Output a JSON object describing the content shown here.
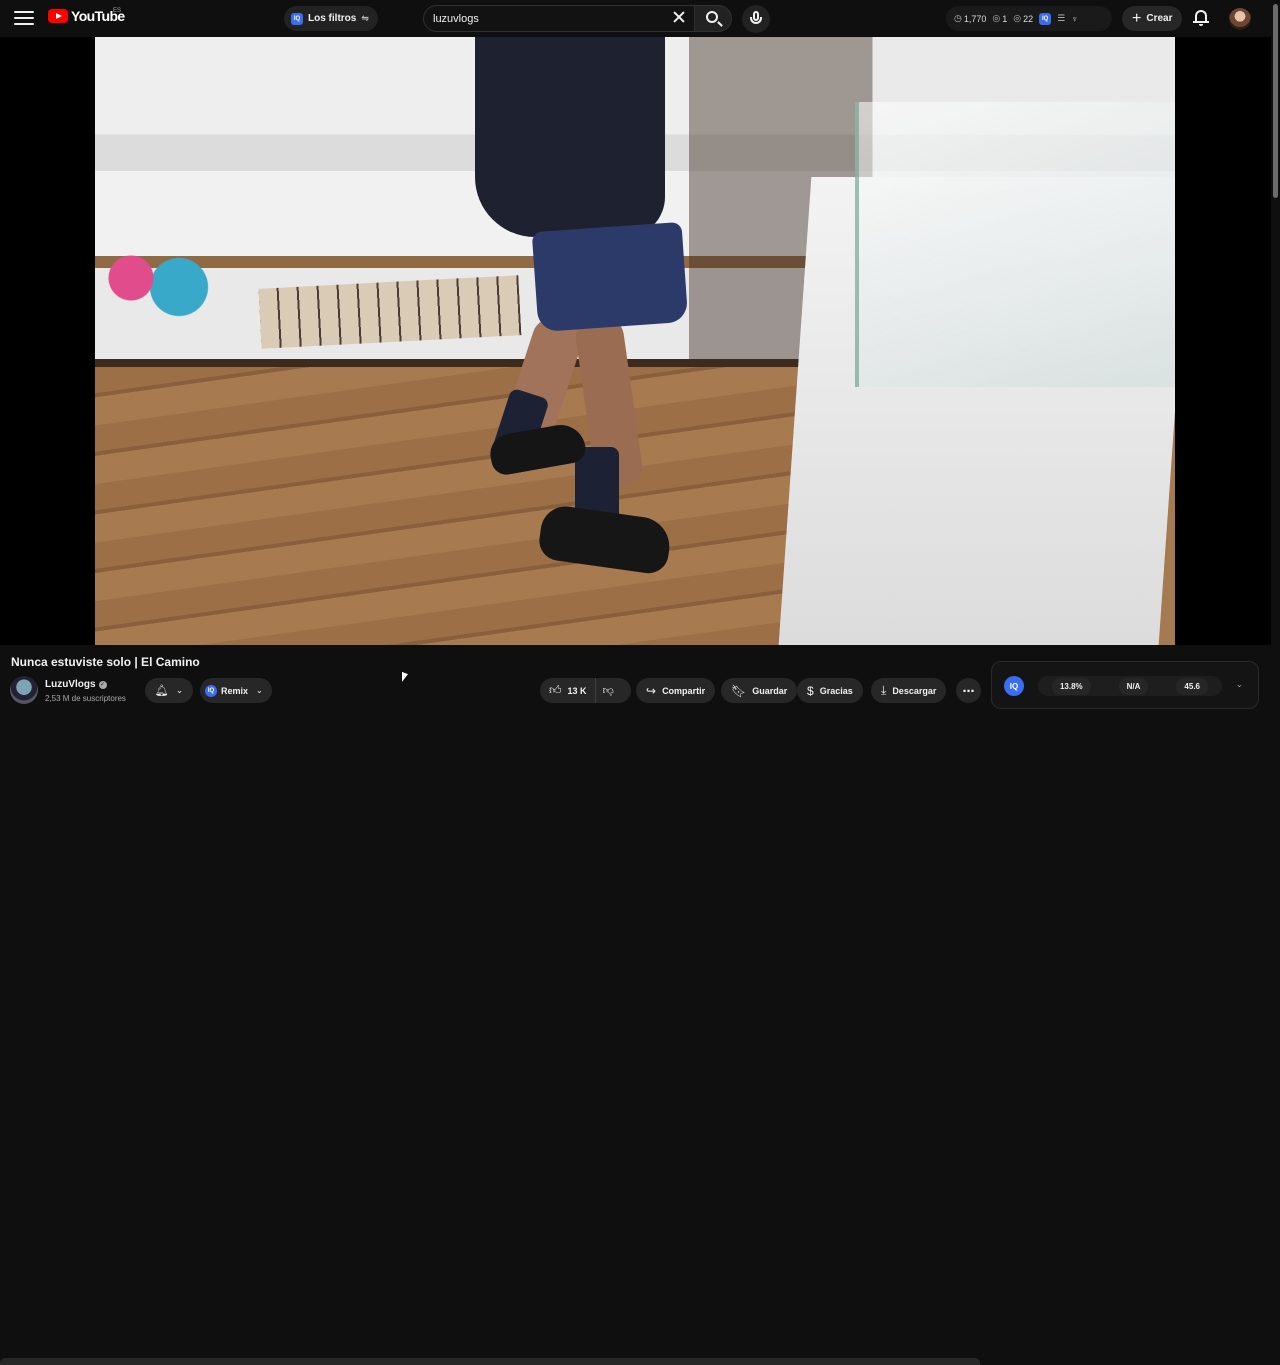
{
  "header": {
    "logo_text": "YouTube",
    "country_code": "ES",
    "filters_label": "Los filtros",
    "search_value": "luzuvlogs",
    "stats": {
      "count_1": "1,770",
      "count_2": "1",
      "count_3": "22"
    },
    "create_label": "Crear"
  },
  "video": {
    "title": "Nunca estuviste solo | El Camino"
  },
  "channel": {
    "name": "LuzuVlogs",
    "subscribers": "2,53 M de suscriptores"
  },
  "actions": {
    "remix_label": "Remix",
    "likes": "13 K",
    "share_label": "Compartir",
    "save_label": "Guardar",
    "thanks_label": "Gracias",
    "download_label": "Descargar"
  },
  "iq_panel": {
    "logo_text": "IQ",
    "metric_1": "13.8%",
    "metric_2": "N/A",
    "metric_3": "45.6"
  },
  "icons": {
    "menu": "menu-icon",
    "search": "search-icon",
    "mic": "mic-icon",
    "bell": "bell-icon",
    "like": "thumbs-up-icon",
    "dislike": "thumbs-down-icon",
    "share": "share-icon",
    "save": "bookmark-icon",
    "thanks": "thanks-icon",
    "download": "download-icon"
  },
  "colors": {
    "brand": "#ff0000",
    "accent": "#3b6df0",
    "background": "#0f0f0f"
  }
}
